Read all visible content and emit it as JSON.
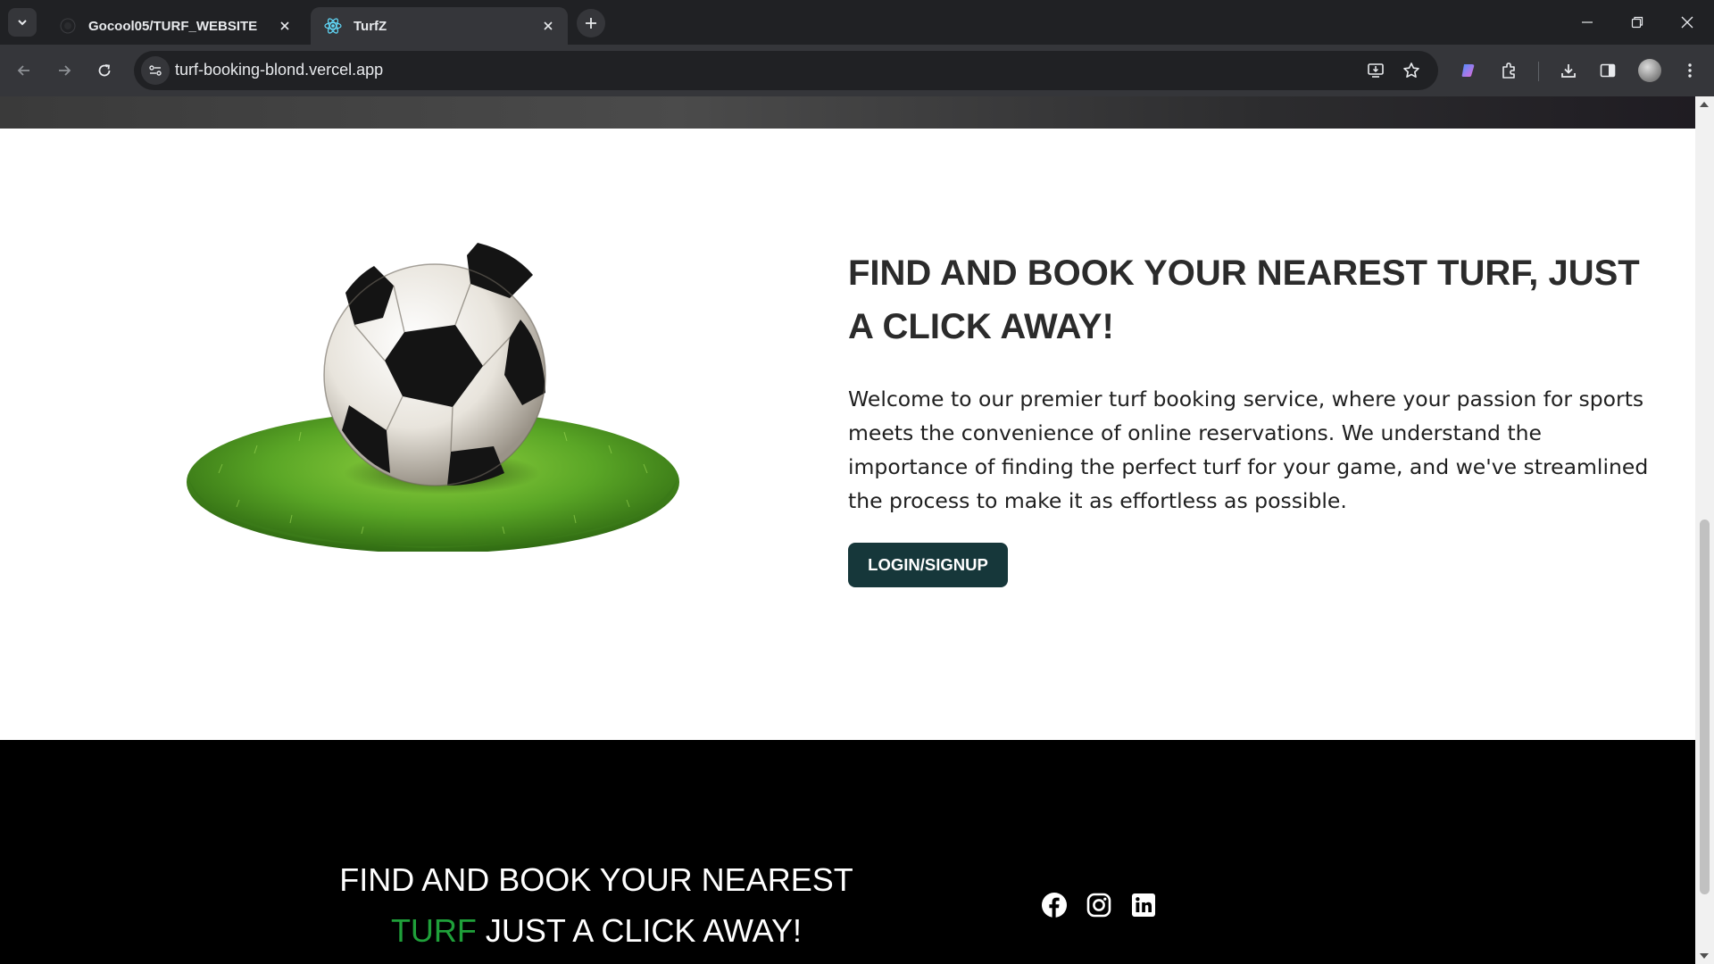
{
  "browser": {
    "tabs": [
      {
        "label": "Gocool05/TURF_WEBSITE",
        "active": false,
        "favicon": "github-icon"
      },
      {
        "label": "TurfZ",
        "active": true,
        "favicon": "react-icon"
      }
    ],
    "url": "turf-booking-blond.vercel.app"
  },
  "hero": {
    "title": "FIND AND BOOK YOUR NEAREST TURF, JUST A CLICK AWAY!",
    "description": "Welcome to our premier turf booking service, where your passion for sports meets the convenience of online reservations. We understand the importance of finding the perfect turf for your game, and we've streamlined the process to make it as effortless as possible.",
    "cta_label": "LOGIN/SIGNUP"
  },
  "footer": {
    "tagline_line1": "FIND AND BOOK YOUR NEAREST",
    "tagline_accent": "TURF",
    "tagline_rest": " JUST A CLICK AWAY!",
    "socials": [
      "facebook-icon",
      "instagram-icon",
      "linkedin-icon"
    ]
  },
  "colors": {
    "cta_background": "#16373a",
    "footer_background": "#000000",
    "accent_green": "#1fa03a",
    "chrome_dark": "#202124"
  }
}
